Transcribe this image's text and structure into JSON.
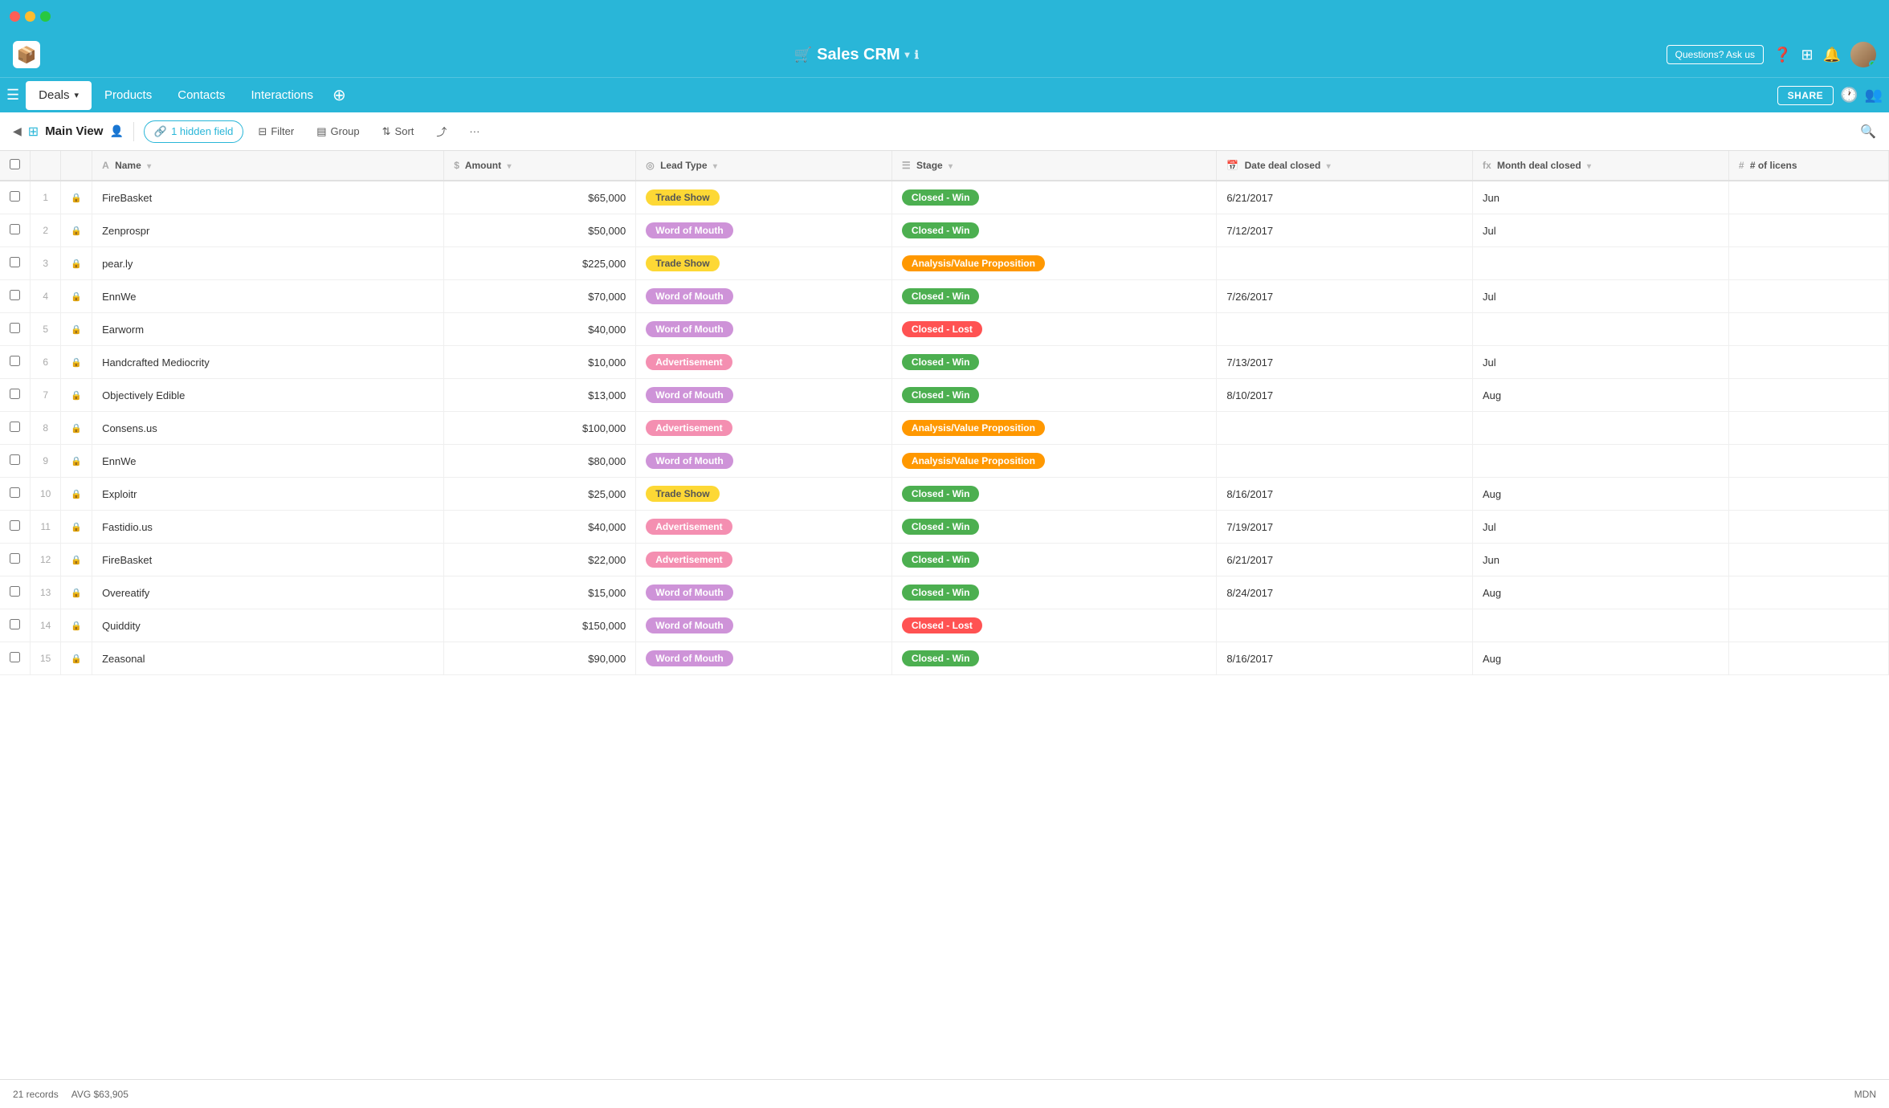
{
  "titleBar": {
    "trafficLights": [
      "red",
      "yellow",
      "green"
    ]
  },
  "header": {
    "title": "Sales CRM",
    "askUs": "Questions? Ask us",
    "icons": [
      "❓",
      "⊞",
      "🔔"
    ]
  },
  "nav": {
    "tabs": [
      {
        "label": "Deals",
        "active": true,
        "hasDropdown": true
      },
      {
        "label": "Products",
        "active": false
      },
      {
        "label": "Contacts",
        "active": false
      },
      {
        "label": "Interactions",
        "active": false
      }
    ],
    "shareLabel": "SHARE"
  },
  "toolbar": {
    "mainViewLabel": "Main View",
    "hiddenFieldBtn": "1 hidden field",
    "filterBtn": "Filter",
    "groupBtn": "Group",
    "sortBtn": "Sort"
  },
  "table": {
    "columns": [
      {
        "label": "Name",
        "icon": "A",
        "iconType": "text"
      },
      {
        "label": "Amount",
        "icon": "$",
        "iconType": "dollar"
      },
      {
        "label": "Lead Type",
        "icon": "◎",
        "iconType": "circle"
      },
      {
        "label": "Stage",
        "icon": "☰",
        "iconType": "lines"
      },
      {
        "label": "Date deal closed",
        "icon": "📅",
        "iconType": "calendar"
      },
      {
        "label": "Month deal closed",
        "icon": "fx",
        "iconType": "formula"
      },
      {
        "label": "# of licens",
        "icon": "#",
        "iconType": "hash"
      }
    ],
    "rows": [
      {
        "num": 1,
        "name": "FireBasket",
        "amount": "$65,000",
        "leadType": "Trade Show",
        "leadTypeClass": "badge-trade-show",
        "stage": "Closed - Win",
        "stageClass": "badge-closed-win",
        "dateClosed": "6/21/2017",
        "monthClosed": "Jun"
      },
      {
        "num": 2,
        "name": "Zenprospr",
        "amount": "$50,000",
        "leadType": "Word of Mouth",
        "leadTypeClass": "badge-word-of-mouth",
        "stage": "Closed - Win",
        "stageClass": "badge-closed-win",
        "dateClosed": "7/12/2017",
        "monthClosed": "Jul"
      },
      {
        "num": 3,
        "name": "pear.ly",
        "amount": "$225,000",
        "leadType": "Trade Show",
        "leadTypeClass": "badge-trade-show",
        "stage": "Analysis/Value Proposition",
        "stageClass": "badge-analysis",
        "dateClosed": "",
        "monthClosed": ""
      },
      {
        "num": 4,
        "name": "EnnWe",
        "amount": "$70,000",
        "leadType": "Word of Mouth",
        "leadTypeClass": "badge-word-of-mouth",
        "stage": "Closed - Win",
        "stageClass": "badge-closed-win",
        "dateClosed": "7/26/2017",
        "monthClosed": "Jul"
      },
      {
        "num": 5,
        "name": "Earworm",
        "amount": "$40,000",
        "leadType": "Word of Mouth",
        "leadTypeClass": "badge-word-of-mouth",
        "stage": "Closed - Lost",
        "stageClass": "badge-closed-lost",
        "dateClosed": "",
        "monthClosed": ""
      },
      {
        "num": 6,
        "name": "Handcrafted Mediocrity",
        "amount": "$10,000",
        "leadType": "Advertisement",
        "leadTypeClass": "badge-advertisement",
        "stage": "Closed - Win",
        "stageClass": "badge-closed-win",
        "dateClosed": "7/13/2017",
        "monthClosed": "Jul"
      },
      {
        "num": 7,
        "name": "Objectively Edible",
        "amount": "$13,000",
        "leadType": "Word of Mouth",
        "leadTypeClass": "badge-word-of-mouth",
        "stage": "Closed - Win",
        "stageClass": "badge-closed-win",
        "dateClosed": "8/10/2017",
        "monthClosed": "Aug"
      },
      {
        "num": 8,
        "name": "Consens.us",
        "amount": "$100,000",
        "leadType": "Advertisement",
        "leadTypeClass": "badge-advertisement",
        "stage": "Analysis/Value Proposition",
        "stageClass": "badge-analysis",
        "dateClosed": "",
        "monthClosed": ""
      },
      {
        "num": 9,
        "name": "EnnWe",
        "amount": "$80,000",
        "leadType": "Word of Mouth",
        "leadTypeClass": "badge-word-of-mouth",
        "stage": "Analysis/Value Proposition",
        "stageClass": "badge-analysis",
        "dateClosed": "",
        "monthClosed": ""
      },
      {
        "num": 10,
        "name": "Exploitr",
        "amount": "$25,000",
        "leadType": "Trade Show",
        "leadTypeClass": "badge-trade-show",
        "stage": "Closed - Win",
        "stageClass": "badge-closed-win",
        "dateClosed": "8/16/2017",
        "monthClosed": "Aug"
      },
      {
        "num": 11,
        "name": "Fastidio.us",
        "amount": "$40,000",
        "leadType": "Advertisement",
        "leadTypeClass": "badge-advertisement",
        "stage": "Closed - Win",
        "stageClass": "badge-closed-win",
        "dateClosed": "7/19/2017",
        "monthClosed": "Jul"
      },
      {
        "num": 12,
        "name": "FireBasket",
        "amount": "$22,000",
        "leadType": "Advertisement",
        "leadTypeClass": "badge-advertisement",
        "stage": "Closed - Win",
        "stageClass": "badge-closed-win",
        "dateClosed": "6/21/2017",
        "monthClosed": "Jun"
      },
      {
        "num": 13,
        "name": "Overeatify",
        "amount": "$15,000",
        "leadType": "Word of Mouth",
        "leadTypeClass": "badge-word-of-mouth",
        "stage": "Closed - Win",
        "stageClass": "badge-closed-win",
        "dateClosed": "8/24/2017",
        "monthClosed": "Aug"
      },
      {
        "num": 14,
        "name": "Quiddity",
        "amount": "$150,000",
        "leadType": "Word of Mouth",
        "leadTypeClass": "badge-word-of-mouth",
        "stage": "Closed - Lost",
        "stageClass": "badge-closed-lost",
        "dateClosed": "",
        "monthClosed": ""
      },
      {
        "num": 15,
        "name": "Zeasonal",
        "amount": "$90,000",
        "leadType": "Word of Mouth",
        "leadTypeClass": "badge-word-of-mouth",
        "stage": "Closed - Win",
        "stageClass": "badge-closed-win",
        "dateClosed": "8/16/2017",
        "monthClosed": "Aug"
      }
    ]
  },
  "statusBar": {
    "recordCount": "21 records",
    "avgLabel": "AVG $63,905",
    "mdnLabel": "MDN"
  }
}
